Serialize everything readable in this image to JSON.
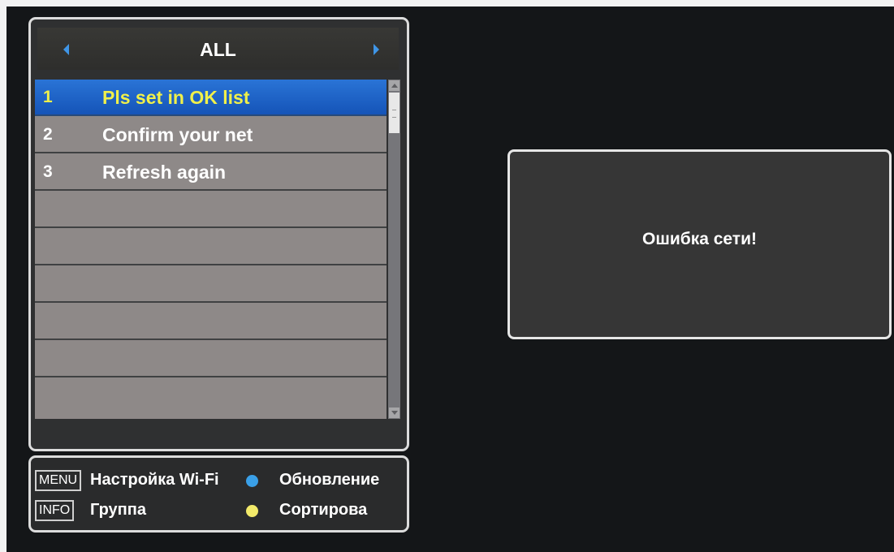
{
  "channel_list": {
    "group_title": "ALL",
    "prev_icon": "triangle-left-icon",
    "next_icon": "triangle-right-icon",
    "items": [
      {
        "number": "1",
        "name": "Pls set in OK list",
        "selected": true
      },
      {
        "number": "2",
        "name": "Confirm your net",
        "selected": false
      },
      {
        "number": "3",
        "name": "Refresh again",
        "selected": false
      },
      {
        "number": "",
        "name": "",
        "selected": false
      },
      {
        "number": "",
        "name": "",
        "selected": false
      },
      {
        "number": "",
        "name": "",
        "selected": false
      },
      {
        "number": "",
        "name": "",
        "selected": false
      },
      {
        "number": "",
        "name": "",
        "selected": false
      },
      {
        "number": "",
        "name": "",
        "selected": false
      }
    ],
    "colors": {
      "selected_row": "#1f63c8",
      "selected_text": "#f0f04a",
      "list_background": "#8e8988"
    }
  },
  "legend": {
    "menu_key": "MENU",
    "menu_label": "Настройка Wi-Fi",
    "info_key": "INFO",
    "info_label": "Группа",
    "blue_label": "Обновление",
    "yellow_label": "Сортирова",
    "colors": {
      "blue": "#3aa0e8",
      "yellow": "#f2ea6a"
    }
  },
  "dialog": {
    "message": "Ошибка сети!"
  }
}
